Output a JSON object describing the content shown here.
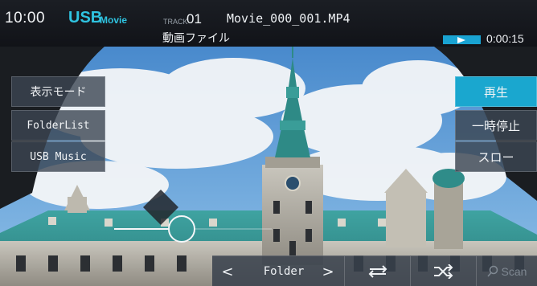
{
  "status": {
    "time": "10:00",
    "source": "USB",
    "source_sub": "Movie",
    "track_label": "TRACK",
    "track_number": "01",
    "file_name": "Movie_000_001.MP4",
    "file_type": "動画ファイル",
    "elapsed": "0:00:15"
  },
  "left_menu": {
    "display_mode": "表示モード",
    "folder_list": "FolderList",
    "usb_music": "USB Music"
  },
  "right_menu": {
    "play": "再生",
    "pause": "一時停止",
    "slow": "スロー"
  },
  "bottom_bar": {
    "prev": "<",
    "folder": "Folder",
    "next": ">",
    "scan": "Scan"
  },
  "colors": {
    "accent": "#1aa7cf",
    "source_text": "#2fc3e0",
    "panel": "#3c4652"
  },
  "icons": [
    "play-icon",
    "repeat-icon",
    "shuffle-icon",
    "search-icon"
  ]
}
